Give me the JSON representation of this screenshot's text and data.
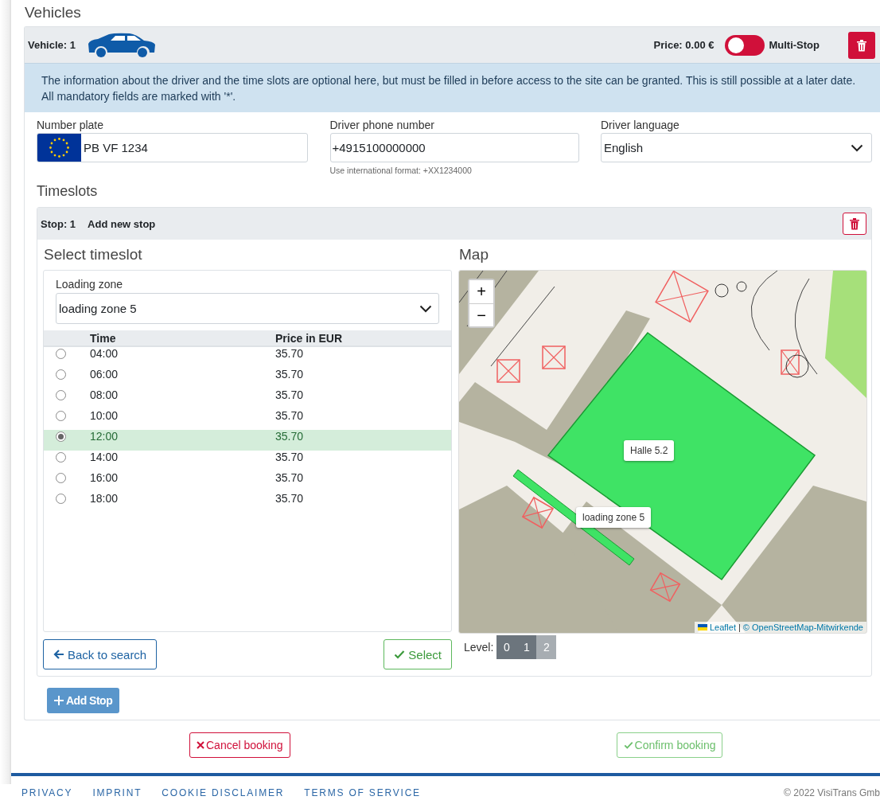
{
  "section_title": "Vehicles",
  "vehicle": {
    "label": "Vehicle: 1",
    "price": "Price: 0.00 €",
    "multi_stop": {
      "label": "Multi-Stop",
      "on": false
    }
  },
  "info": "The information about the driver and the time slots are optional here, but must be filled in before access to the site can be granted. This is still possible at a later date. All mandatory fields are marked with '*'.",
  "fields": [
    {
      "kind": "plate",
      "label": "Number plate",
      "value": "PB VF 1234"
    },
    {
      "kind": "text",
      "label": "Driver phone number",
      "value": "+4915100000000",
      "hint": "Use international format: +XX1234000"
    },
    {
      "kind": "select",
      "label": "Driver language",
      "value": "English"
    }
  ],
  "timeslots_title": "Timeslots",
  "stop": {
    "label": "Stop: 1",
    "add_label": "Add new stop",
    "select_title": "Select timeslot",
    "zone_label": "Loading zone",
    "zone_value": "loading zone 5",
    "columns": [
      "Time",
      "Price in EUR"
    ],
    "slots": [
      {
        "time": "04:00",
        "price": "35.70",
        "selected": false
      },
      {
        "time": "06:00",
        "price": "35.70",
        "selected": false
      },
      {
        "time": "08:00",
        "price": "35.70",
        "selected": false
      },
      {
        "time": "10:00",
        "price": "35.70",
        "selected": false
      },
      {
        "time": "12:00",
        "price": "35.70",
        "selected": true
      },
      {
        "time": "14:00",
        "price": "35.70",
        "selected": false
      },
      {
        "time": "16:00",
        "price": "35.70",
        "selected": false
      },
      {
        "time": "18:00",
        "price": "35.70",
        "selected": false
      }
    ],
    "back_button": "Back to search",
    "select_button": "Select",
    "map_title": "Map",
    "map": {
      "zoom_in": "+",
      "zoom_out": "−",
      "tooltips": [
        "Halle 5.2",
        "loading zone 5"
      ],
      "attribution": [
        "Leaflet",
        "|",
        "© OpenStreetMap-Mitwirkende"
      ]
    },
    "level_label": "Level:",
    "levels": [
      {
        "label": "0",
        "selected": false
      },
      {
        "label": "1",
        "selected": false
      },
      {
        "label": "2",
        "selected": true
      }
    ]
  },
  "add_stop": "Add Stop",
  "cancel": "Cancel booking",
  "confirm": "Confirm booking",
  "footer": {
    "links": [
      "PRIVACY",
      "IMPRINT",
      "COOKIE DISCLAIMER",
      "TERMS OF SERVICE"
    ],
    "copyright": "© 2022 VisiTrans Gmb"
  }
}
